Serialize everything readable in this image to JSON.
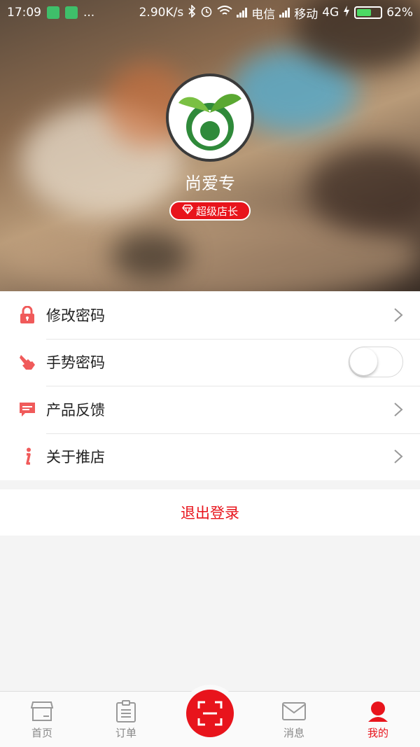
{
  "status_bar": {
    "time": "17:09",
    "dots": "...",
    "speed": "2.90K/s",
    "carrier1": "电信",
    "carrier2": "移动",
    "network": "4G",
    "battery": "62%",
    "battery_level": 0.62
  },
  "profile": {
    "name": "尚爱专",
    "badge": "超级店长",
    "avatar_icon": "sprout-logo-icon"
  },
  "menu": {
    "items": [
      {
        "label": "修改密码",
        "icon": "lock-icon",
        "control": "chevron"
      },
      {
        "label": "手势密码",
        "icon": "hand-pointer-icon",
        "control": "toggle",
        "toggle_on": false
      },
      {
        "label": "产品反馈",
        "icon": "chat-bubble-icon",
        "control": "chevron"
      },
      {
        "label": "关于推店",
        "icon": "info-icon",
        "control": "chevron"
      }
    ]
  },
  "logout_label": "退出登录",
  "tabbar": {
    "tabs": [
      {
        "label": "首页",
        "icon": "store-icon",
        "active": false
      },
      {
        "label": "订单",
        "icon": "clipboard-icon",
        "active": false
      },
      {
        "label": "",
        "icon": "scan-icon",
        "active": false
      },
      {
        "label": "消息",
        "icon": "mail-icon",
        "active": false
      },
      {
        "label": "我的",
        "icon": "user-icon",
        "active": true
      }
    ]
  },
  "colors": {
    "accent": "#e8141c",
    "icon_red": "#f05a5a",
    "inactive": "#888888"
  }
}
